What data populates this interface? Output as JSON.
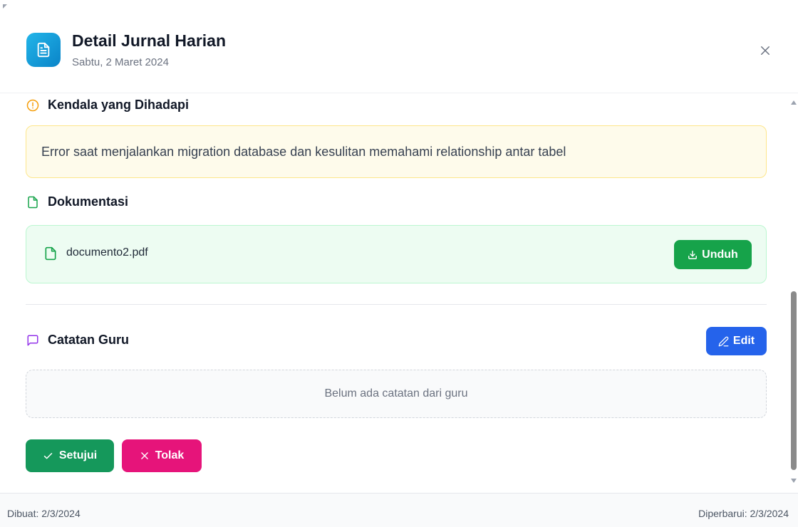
{
  "header": {
    "title": "Detail Jurnal Harian",
    "date": "Sabtu, 2 Maret 2024",
    "icon": "document-icon",
    "close_icon": "close-icon"
  },
  "kendala": {
    "title": "Kendala yang Dihadapi",
    "icon": "alert-circle-icon",
    "text": "Error saat menjalankan migration database dan kesulitan memahami relationship antar tabel"
  },
  "dokumentasi": {
    "title": "Dokumentasi",
    "icon": "file-icon",
    "file_name": "documento2.pdf",
    "download_label": "Unduh"
  },
  "catatan": {
    "title": "Catatan Guru",
    "icon": "message-square-icon",
    "edit_label": "Edit",
    "empty_text": "Belum ada catatan dari guru"
  },
  "actions": {
    "approve_label": "Setujui",
    "reject_label": "Tolak"
  },
  "footer": {
    "created": "Dibuat: 2/3/2024",
    "updated": "Diperbarui: 2/3/2024"
  },
  "colors": {
    "primary": "#2563eb",
    "success": "#16a34a",
    "approve": "#15985b",
    "reject": "#e6147a",
    "warning": "#f59e0b",
    "purple": "#9333ea"
  }
}
